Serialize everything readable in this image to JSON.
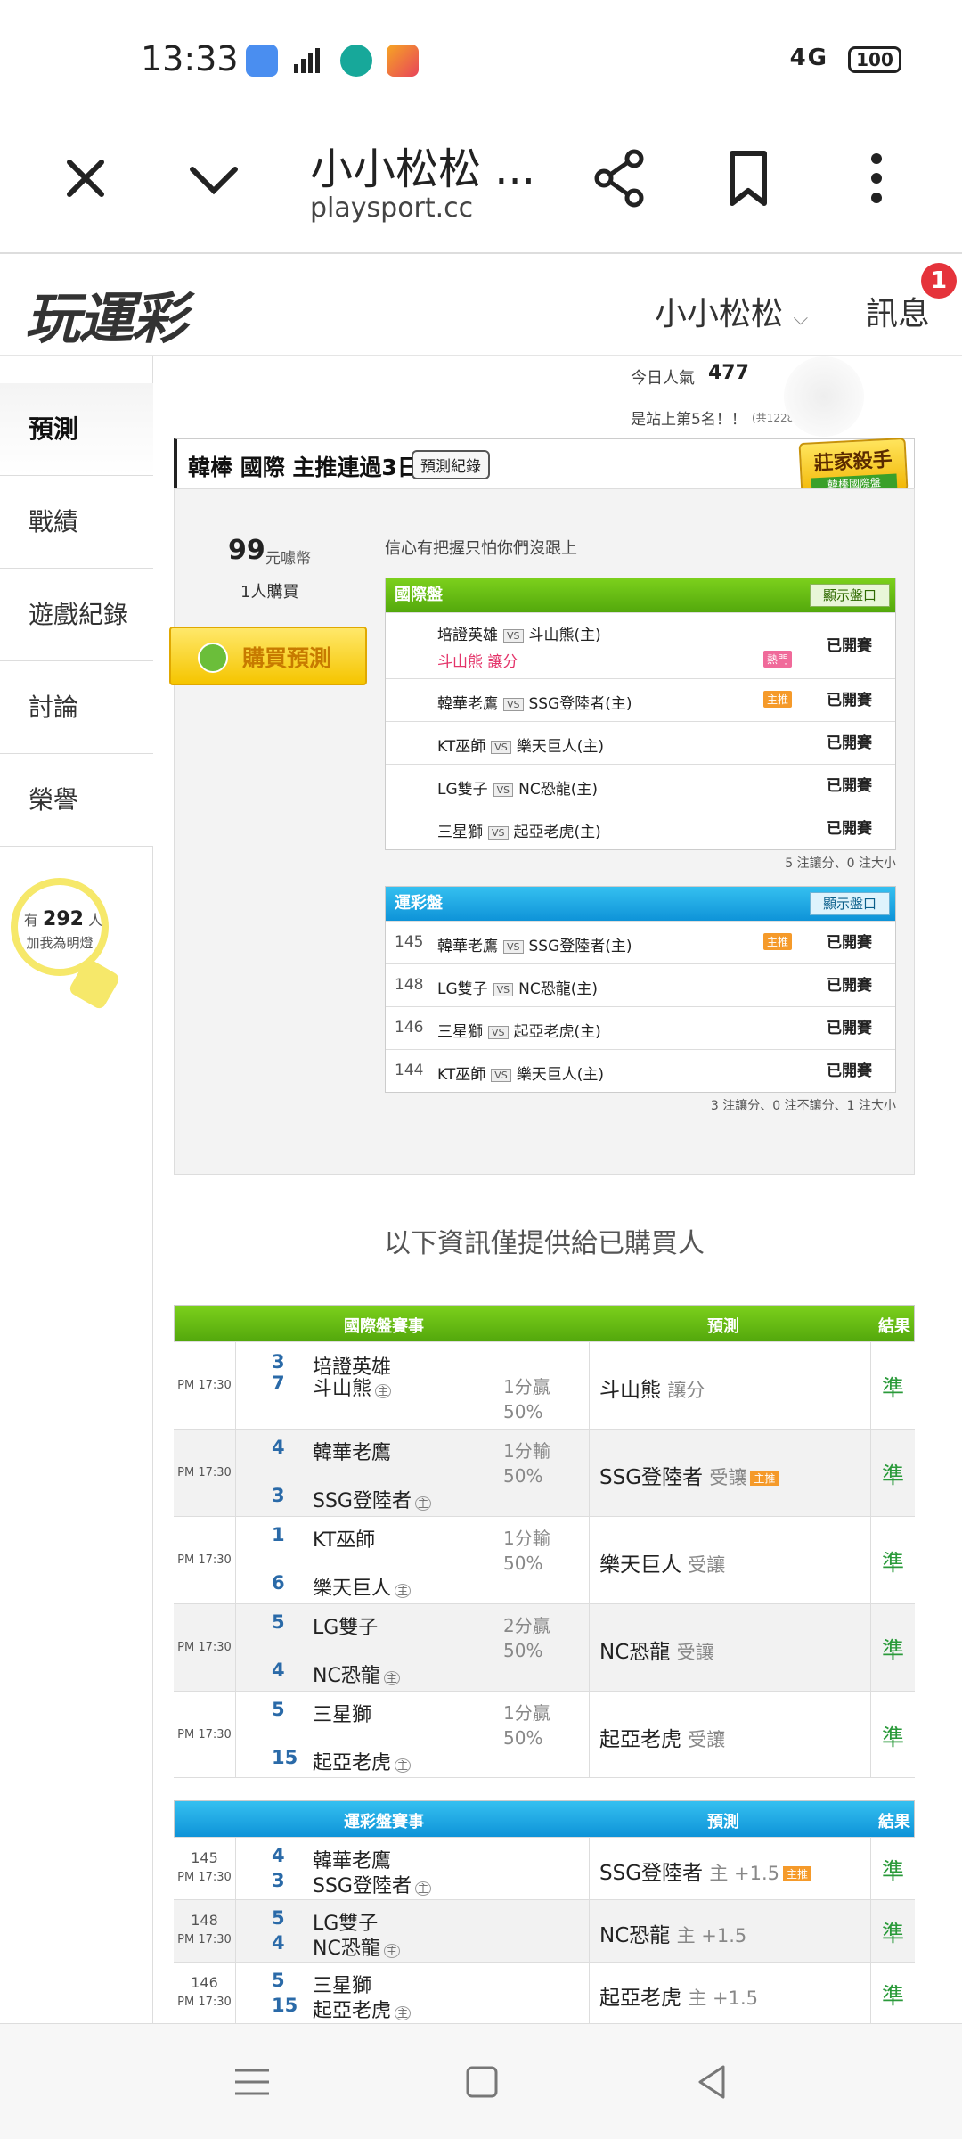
{
  "status_bar": {
    "time": "13:33",
    "network": "4G",
    "battery": "100",
    "icons": [
      "app-icon-blue",
      "signal-chart-icon",
      "teal-app-icon",
      "game-app-icon"
    ]
  },
  "browser": {
    "title": "小小松松 ...",
    "url": "playsport.cc",
    "icons": [
      "close-icon",
      "chevron-down-icon",
      "share-icon",
      "bookmark-icon",
      "more-vert-icon"
    ]
  },
  "site_header": {
    "logo": "玩運彩",
    "username": "小小松松",
    "messages_label": "訊息",
    "messages_badge": "1"
  },
  "sidebar": {
    "items": [
      "預測",
      "戰績",
      "遊戲紀錄",
      "討論",
      "榮譽"
    ],
    "followers_prefix": "有",
    "followers_count": "292",
    "followers_suffix": "人",
    "followers_cta": "加我為明燈"
  },
  "popularity": {
    "label": "今日人氣",
    "value": "477",
    "rank": "是站上第5名！！",
    "rank_total": "(共12282人)"
  },
  "prediction_panel": {
    "title": "韓棒 國際 主推連過3日",
    "record_button": "預測紀錄",
    "badge_title": "莊家殺手",
    "badge_sub": "韓棒國際盤",
    "price_value": "99",
    "price_unit": "元噱幣",
    "buyers": "1人購買",
    "buy_button": "購買預測",
    "slogan": "信心有把握只怕你們沒跟上"
  },
  "intl_table": {
    "header": "國際盤",
    "show_button": "顯示盤口",
    "rows": [
      {
        "away": "培證英雄",
        "vs": "VS",
        "home": "斗山熊(主)",
        "pick": "斗山熊",
        "pick_type": "讓分",
        "tag": "熱門",
        "status": "已開賽"
      },
      {
        "away": "韓華老鷹",
        "vs": "VS",
        "home": "SSG登陸者(主)",
        "tag": "主推",
        "status": "已開賽"
      },
      {
        "away": "KT巫師",
        "vs": "VS",
        "home": "樂天巨人(主)",
        "status": "已開賽"
      },
      {
        "away": "LG雙子",
        "vs": "VS",
        "home": "NC恐龍(主)",
        "status": "已開賽"
      },
      {
        "away": "三星獅",
        "vs": "VS",
        "home": "起亞老虎(主)",
        "status": "已開賽"
      }
    ],
    "summary": "5 注讓分、0 注大小"
  },
  "sports_table": {
    "header": "運彩盤",
    "show_button": "顯示盤口",
    "rows": [
      {
        "num": "145",
        "away": "韓華老鷹",
        "vs": "VS",
        "home": "SSG登陸者(主)",
        "tag": "主推",
        "status": "已開賽"
      },
      {
        "num": "148",
        "away": "LG雙子",
        "vs": "VS",
        "home": "NC恐龍(主)",
        "status": "已開賽"
      },
      {
        "num": "146",
        "away": "三星獅",
        "vs": "VS",
        "home": "起亞老虎(主)",
        "status": "已開賽"
      },
      {
        "num": "144",
        "away": "KT巫師",
        "vs": "VS",
        "home": "樂天巨人(主)",
        "status": "已開賽"
      }
    ],
    "summary": "3 注讓分、0 注不讓分、1 注大小"
  },
  "notice": "以下資訊僅提供給已購買人",
  "intl_results": {
    "headers": [
      "國際盤賽事",
      "預測",
      "結果"
    ],
    "home_mark": "主",
    "rows": [
      {
        "time": "PM 17:30",
        "s1": "3",
        "t1": "培證英雄",
        "s2": "7",
        "t2": "斗山熊",
        "res": "1分贏",
        "pct": "50%",
        "pred": "斗山熊",
        "pred_sub": "讓分",
        "tag": "",
        "acc": "準"
      },
      {
        "time": "PM 17:30",
        "s1": "4",
        "t1": "韓華老鷹",
        "s2": "3",
        "t2": "SSG登陸者",
        "res": "1分輸",
        "pct": "50%",
        "pred": "SSG登陸者",
        "pred_sub": "受讓",
        "tag": "主推",
        "acc": "準"
      },
      {
        "time": "PM 17:30",
        "s1": "1",
        "t1": "KT巫師",
        "s2": "6",
        "t2": "樂天巨人",
        "res": "1分輸",
        "pct": "50%",
        "pred": "樂天巨人",
        "pred_sub": "受讓",
        "tag": "",
        "acc": "準"
      },
      {
        "time": "PM 17:30",
        "s1": "5",
        "t1": "LG雙子",
        "s2": "4",
        "t2": "NC恐龍",
        "res": "2分贏",
        "pct": "50%",
        "pred": "NC恐龍",
        "pred_sub": "受讓",
        "tag": "",
        "acc": "準"
      },
      {
        "time": "PM 17:30",
        "s1": "5",
        "t1": "三星獅",
        "s2": "15",
        "t2": "起亞老虎",
        "res": "1分贏",
        "pct": "50%",
        "pred": "起亞老虎",
        "pred_sub": "受讓",
        "tag": "",
        "acc": "準"
      }
    ]
  },
  "sports_results": {
    "headers": [
      "運彩盤賽事",
      "預測",
      "結果"
    ],
    "home_mark": "主",
    "rows": [
      {
        "num": "145",
        "time": "PM 17:30",
        "s1": "4",
        "t1": "韓華老鷹",
        "s2": "3",
        "t2": "SSG登陸者",
        "pred": "SSG登陸者",
        "pred_sub": "主 +1.5",
        "tag": "主推",
        "acc": "準"
      },
      {
        "num": "148",
        "time": "PM 17:30",
        "s1": "5",
        "t1": "LG雙子",
        "s2": "4",
        "t2": "NC恐龍",
        "pred": "NC恐龍",
        "pred_sub": "主 +1.5",
        "tag": "",
        "acc": "準"
      },
      {
        "num": "146",
        "time": "PM 17:30",
        "s1": "5",
        "t1": "三星獅",
        "s2": "15",
        "t2": "起亞老虎",
        "pred": "起亞老虎",
        "pred_sub": "主 +1.5",
        "tag": "",
        "acc": "準"
      }
    ]
  },
  "colors": {
    "green": "#5cb814",
    "blue": "#1aa3e0",
    "accurate": "#2a9a3a",
    "score": "#2a6aa8",
    "badge": "#e5333b"
  }
}
